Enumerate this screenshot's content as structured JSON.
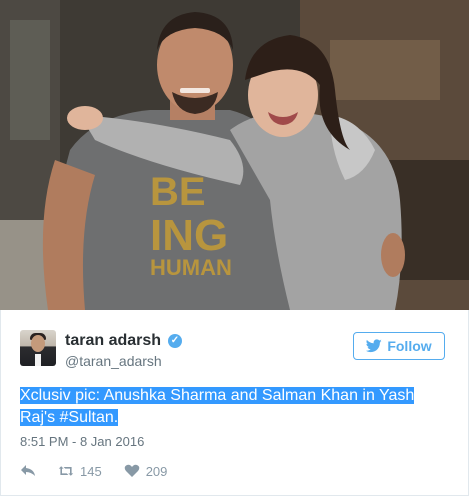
{
  "tweet": {
    "author_name": "taran adarsh",
    "handle": "@taran_adarsh",
    "verified_icon": "verified-badge-icon",
    "follow_label": "Follow",
    "text": "Xclusiv pic: Anushka Sharma and Salman Khan in Yash Raj's #Sultan.",
    "timestamp": "8:51 PM - 8 Jan 2016",
    "retweets": "145",
    "likes": "209"
  },
  "photo": {
    "shirt_text_line1": "BE",
    "shirt_text_line2": "ING",
    "shirt_text_line3": "HUMAN"
  },
  "colors": {
    "accent": "#55acee",
    "selection": "#3399ff",
    "muted": "#66757f"
  }
}
